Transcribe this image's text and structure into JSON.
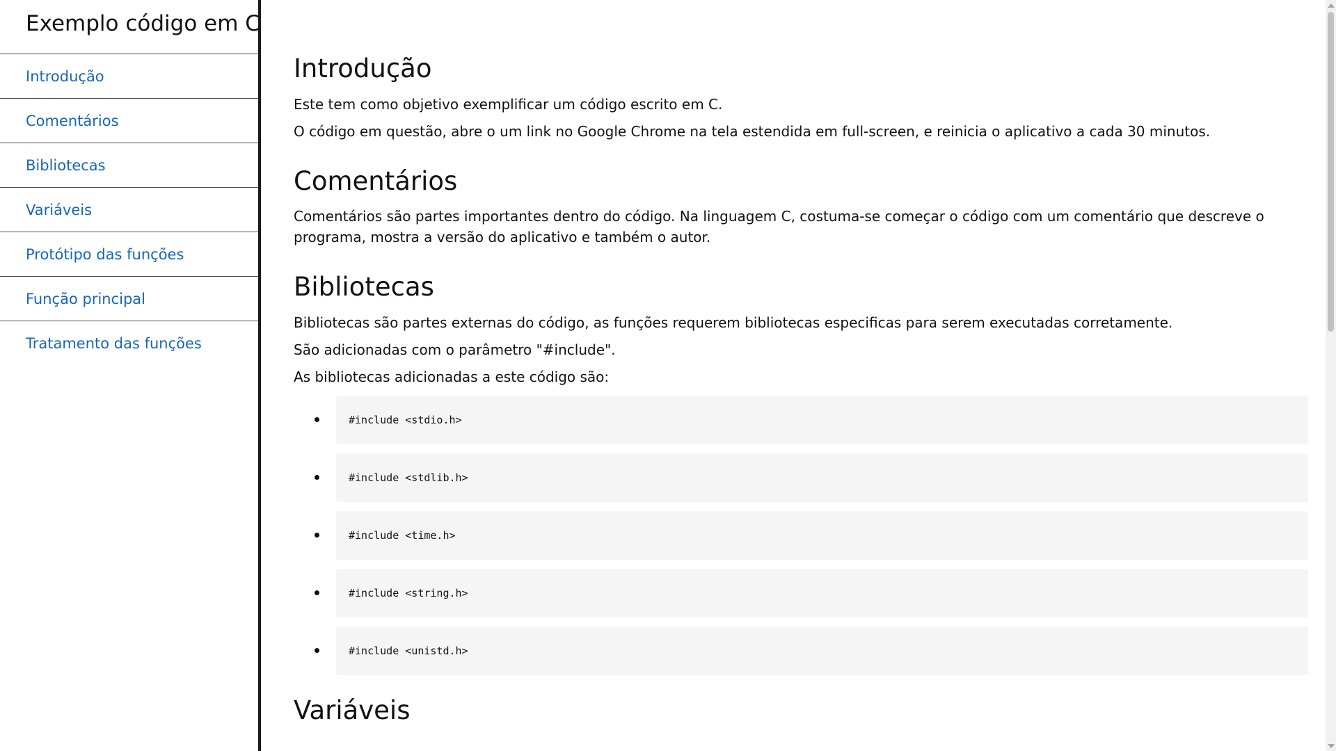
{
  "sidebar": {
    "title": "Exemplo código em C",
    "items": [
      {
        "label": "Introdução"
      },
      {
        "label": "Comentários"
      },
      {
        "label": "Bibliotecas"
      },
      {
        "label": "Variáveis"
      },
      {
        "label": "Protótipo das funções"
      },
      {
        "label": "Função principal"
      },
      {
        "label": "Tratamento das funções"
      }
    ]
  },
  "main": {
    "intro": {
      "title": "Introdução",
      "p1": "Este tem como objetivo exemplificar um código escrito em C.",
      "p2": "O código em questão, abre o um link no Google Chrome na tela estendida em full-screen, e reinicia o aplicativo a cada 30 minutos."
    },
    "comments": {
      "title": "Comentários",
      "p1": "Comentários são partes importantes dentro do código. Na linguagem C, costuma-se começar o código com um comentário que descreve o programa, mostra a versão do aplicativo e também o autor."
    },
    "libraries": {
      "title": "Bibliotecas",
      "p1": "Bibliotecas são partes externas do código, as funções requerem bibliotecas especificas para serem executadas corretamente.",
      "p2": "São adicionadas com o parâmetro \"#include\".",
      "p3": "As bibliotecas adicionadas a este código são:",
      "includes": [
        "#include <stdio.h>",
        "#include <stdlib.h>",
        "#include <time.h>",
        "#include <string.h>",
        "#include <unistd.h>"
      ]
    },
    "variables": {
      "title": "Variáveis"
    }
  }
}
